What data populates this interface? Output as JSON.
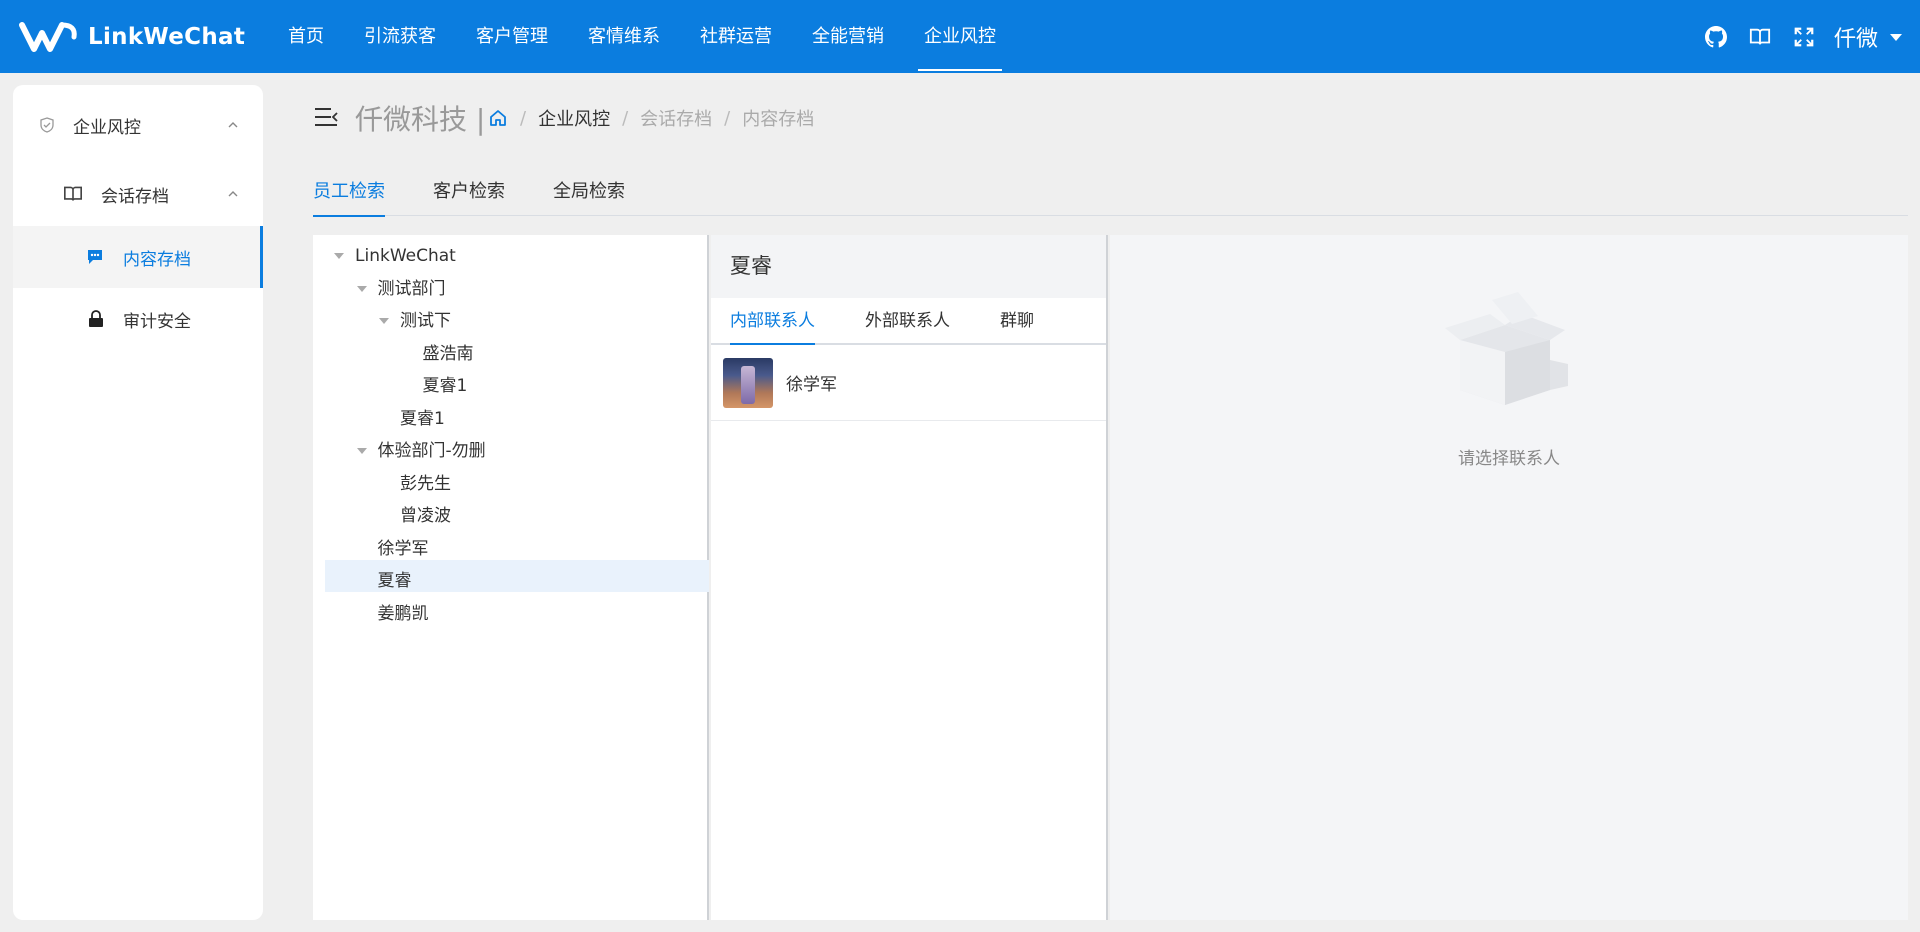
{
  "brand": {
    "name": "LinkWeChat"
  },
  "nav": {
    "items": [
      "首页",
      "引流获客",
      "客户管理",
      "客情维系",
      "社群运营",
      "全能营销",
      "企业风控"
    ],
    "active_index": 6
  },
  "header_right": {
    "icons": [
      "github-icon",
      "book-icon",
      "fullscreen-icon"
    ],
    "user": "仟微"
  },
  "sidebar": {
    "items": [
      {
        "label": "企业风控",
        "icon": "shield-icon",
        "level": 1,
        "expanded": true
      },
      {
        "label": "会话存档",
        "icon": "book-icon",
        "level": 2,
        "expanded": true
      },
      {
        "label": "内容存档",
        "icon": "chat-icon",
        "level": 3,
        "active": true
      },
      {
        "label": "审计安全",
        "icon": "lock-icon",
        "level": 3
      }
    ]
  },
  "breadcrumb": {
    "company": "仟微科技 |",
    "items": [
      "企业风控",
      "会话存档",
      "内容存档"
    ]
  },
  "tabs": {
    "items": [
      "员工检索",
      "客户检索",
      "全局检索"
    ],
    "active_index": 0
  },
  "tree": {
    "nodes": [
      {
        "label": "LinkWeChat",
        "depth": 0,
        "expanded": true
      },
      {
        "label": "测试部门",
        "depth": 1,
        "expanded": true
      },
      {
        "label": "测试下",
        "depth": 2,
        "expanded": true
      },
      {
        "label": "盛浩南",
        "depth": 3
      },
      {
        "label": "夏睿1",
        "depth": 3
      },
      {
        "label": "夏睿1",
        "depth": 2
      },
      {
        "label": "体验部门-勿删",
        "depth": 1,
        "expanded": true
      },
      {
        "label": "彭先生",
        "depth": 2
      },
      {
        "label": "曾凌波",
        "depth": 2
      },
      {
        "label": "徐学军",
        "depth": 1
      },
      {
        "label": "夏睿",
        "depth": 1,
        "selected": true
      },
      {
        "label": "姜鹏凯",
        "depth": 1
      }
    ]
  },
  "contacts": {
    "title": "夏睿",
    "tabs": [
      "内部联系人",
      "外部联系人",
      "群聊"
    ],
    "active_index": 0,
    "list": [
      {
        "name": "徐学军"
      }
    ]
  },
  "empty": {
    "text": "请选择联系人"
  },
  "colors": {
    "primary": "#0b7ddf",
    "selected_bg": "#e9f2fc",
    "page_bg": "#efefef"
  }
}
